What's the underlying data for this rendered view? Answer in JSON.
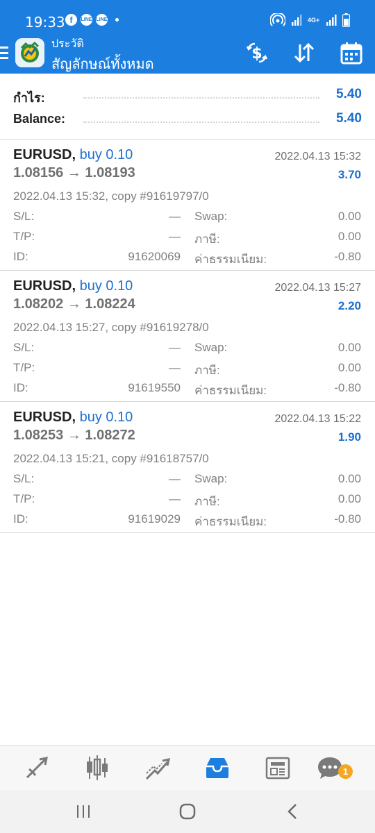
{
  "status_bar": {
    "time": "19:33",
    "app_icons": [
      "facebook-icon",
      "line-icon",
      "line-icon"
    ],
    "app_icon_texts": [
      "f",
      "LINE",
      "LINE"
    ],
    "right_icons": [
      "hotspot-icon",
      "signal-icon",
      "4g-icon",
      "signal-icon",
      "battery-icon"
    ],
    "network_label": "4G+"
  },
  "app_bar": {
    "subtitle": "ประวัติ",
    "title": "สัญลักษณ์ทั้งหมด",
    "actions": [
      "currency-exchange-icon",
      "sort-icon",
      "calendar-icon"
    ]
  },
  "summary": {
    "profit_label": "กำไร:",
    "profit_value": "5.40",
    "balance_label": "Balance:",
    "balance_value": "5.40"
  },
  "trades": [
    {
      "symbol": "EURUSD,",
      "side": "buy 0.10",
      "close_time": "2022.04.13 15:32",
      "prices": "1.08156 → 1.08193",
      "profit": "3.70",
      "open_info": "2022.04.13 15:32, copy #91619797/0",
      "sl_label": "S/L:",
      "sl_value": "—",
      "swap_label": "Swap:",
      "swap_value": "0.00",
      "tp_label": "T/P:",
      "tp_value": "—",
      "tax_label": "ภาษี:",
      "tax_value": "0.00",
      "id_label": "ID:",
      "id_value": "91620069",
      "fee_label": "ค่าธรรมเนียม:",
      "fee_value": "-0.80"
    },
    {
      "symbol": "EURUSD,",
      "side": "buy 0.10",
      "close_time": "2022.04.13 15:27",
      "prices": "1.08202 → 1.08224",
      "profit": "2.20",
      "open_info": "2022.04.13 15:27, copy #91619278/0",
      "sl_label": "S/L:",
      "sl_value": "—",
      "swap_label": "Swap:",
      "swap_value": "0.00",
      "tp_label": "T/P:",
      "tp_value": "—",
      "tax_label": "ภาษี:",
      "tax_value": "0.00",
      "id_label": "ID:",
      "id_value": "91619550",
      "fee_label": "ค่าธรรมเนียม:",
      "fee_value": "-0.80"
    },
    {
      "symbol": "EURUSD,",
      "side": "buy 0.10",
      "close_time": "2022.04.13 15:22",
      "prices": "1.08253 → 1.08272",
      "profit": "1.90",
      "open_info": "2022.04.13 15:21, copy #91618757/0",
      "sl_label": "S/L:",
      "sl_value": "—",
      "swap_label": "Swap:",
      "swap_value": "0.00",
      "tp_label": "T/P:",
      "tp_value": "—",
      "tax_label": "ภาษี:",
      "tax_value": "0.00",
      "id_label": "ID:",
      "id_value": "91619029",
      "fee_label": "ค่าธรรมเนียม:",
      "fee_value": "-0.80"
    }
  ],
  "bottom_tabs": [
    "quotes-icon",
    "chart-icon",
    "trade-icon",
    "history-icon",
    "news-icon",
    "chat-icon"
  ],
  "active_tab": "history-icon",
  "chat_badge": "1",
  "system_nav": [
    "recent-apps-icon",
    "home-icon",
    "back-icon"
  ],
  "colors": {
    "primary": "#1c7fe0",
    "value_blue": "#1c6fd0",
    "badge": "#f5a623"
  }
}
